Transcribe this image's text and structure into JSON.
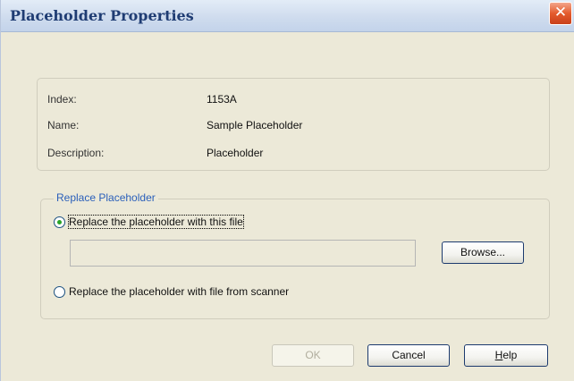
{
  "dialog": {
    "title": "Placeholder Properties",
    "close_glyph": "✕"
  },
  "info": {
    "rows": [
      {
        "label": "Index:",
        "value": "1153A"
      },
      {
        "label": "Name:",
        "value": "Sample Placeholder"
      },
      {
        "label": "Description:",
        "value": "Placeholder"
      }
    ]
  },
  "replace_group": {
    "legend": "Replace Placeholder",
    "option_file": {
      "label": "Replace the placeholder with this file",
      "selected": true
    },
    "option_scanner": {
      "label": "Replace the placeholder with file from scanner",
      "selected": false
    },
    "file_path": "",
    "browse_label": "Browse..."
  },
  "buttons": {
    "ok_label": "OK",
    "cancel_label": "Cancel",
    "help_label_mnemonic": "H",
    "help_label_rest": "elp"
  },
  "colors": {
    "title_text": "#1f3c73",
    "close_button": "#e45b2d",
    "legend_text": "#2a5fba",
    "radio_selected": "#28a428"
  }
}
